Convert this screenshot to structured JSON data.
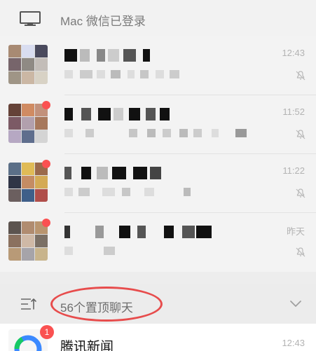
{
  "header": {
    "mac_login_text": "Mac 微信已登录",
    "icon": "monitor-icon"
  },
  "chats": [
    {
      "time": "12:43",
      "muted": true,
      "badge": false,
      "avatar_colors": [
        "#a88a73",
        "#d9ddf0",
        "#4a4a5d",
        "#77656b",
        "#8f8a84",
        "#c3bdb8",
        "#9f9586",
        "#cbb7a4",
        "#d8d2c5"
      ]
    },
    {
      "time": "11:52",
      "muted": true,
      "badge": true,
      "avatar_colors": [
        "#654238",
        "#d08b62",
        "#c2917b",
        "#7c5a65",
        "#b2a0ad",
        "#a7785c",
        "#b6a8c3",
        "#5f6e8d",
        "#d4d4d4"
      ]
    },
    {
      "time": "11:22",
      "muted": true,
      "badge": true,
      "avatar_colors": [
        "#5b6f87",
        "#e0bb56",
        "#9b6a4b",
        "#2f3546",
        "#c58c63",
        "#d4aa55",
        "#6b5f5f",
        "#3f5f89",
        "#b04e4a"
      ]
    },
    {
      "time": "昨天",
      "muted": true,
      "badge": true,
      "avatar_colors": [
        "#5c544f",
        "#b08c70",
        "#b9956f",
        "#8b715f",
        "#cfb9a6",
        "#7b7065",
        "#b89a77",
        "#a6a4a9",
        "#c8b48c"
      ]
    }
  ],
  "pinned_bar": {
    "label": "56个置顶聊天",
    "left_icon": "collapse-list-icon",
    "right_icon": "chevron-down-icon"
  },
  "news": {
    "title": "腾讯新闻",
    "time": "12:43",
    "badge": "1"
  },
  "colors": {
    "badge_red": "#fa5151",
    "annotation_red": "#e74c4c"
  }
}
